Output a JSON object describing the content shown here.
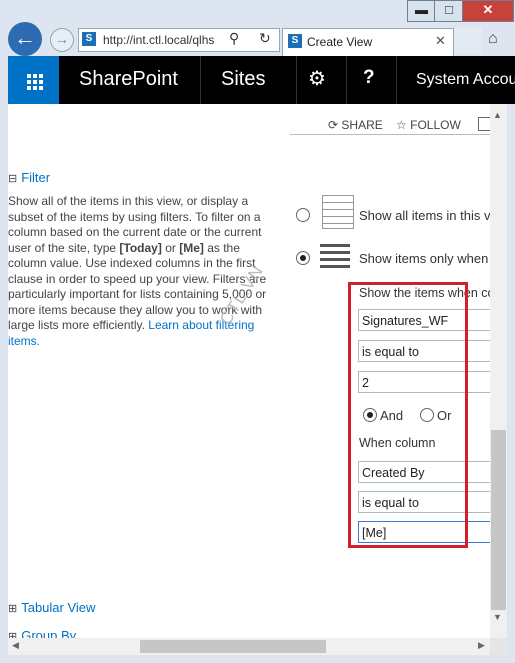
{
  "browser": {
    "window_buttons": {
      "minimize": "▬",
      "maximize": "□",
      "close": "✕"
    },
    "back_icon": "back-arrow-icon",
    "forward_icon": "forward-arrow-icon",
    "address": "http://int.ctl.local/qlhs",
    "tab_title": "Create View",
    "favicon_letter": "S"
  },
  "suite_bar": {
    "brand": "SharePoint",
    "sites": "Sites",
    "help": "?",
    "account": "System Account",
    "accent_color": "#0072c6"
  },
  "page_actions": {
    "share": "SHARE",
    "follow": "FOLLOW"
  },
  "filter": {
    "section_label": "Filter",
    "description_parts": [
      "Show all of the items in this view, or display a subset of the items by using filters. To filter on a column based on the current date or the current user of the site, type ",
      "[Today]",
      " or ",
      "[Me]",
      " as the column value. Use indexed columns in the first clause in order to speed up your view. Filters are particularly important for lists containing 5,000 or more items because they allow you to work with large lists more efficiently. ",
      "Learn about filtering items."
    ],
    "option_all": "Show all items in this view",
    "option_only": "Show items only when the following is true:",
    "show_items_when": "Show the items when column",
    "clause1": {
      "column": "Signatures_WF",
      "operator": "is equal to",
      "value": "2"
    },
    "and_label": "And",
    "or_label": "Or",
    "when_column": "When column",
    "clause2": {
      "column": "Created By",
      "operator": "is equal to",
      "value": "[Me]"
    }
  },
  "watermark": "CTL.VN",
  "sections": {
    "tabular_view": "Tabular View",
    "group_by": "Group By"
  }
}
